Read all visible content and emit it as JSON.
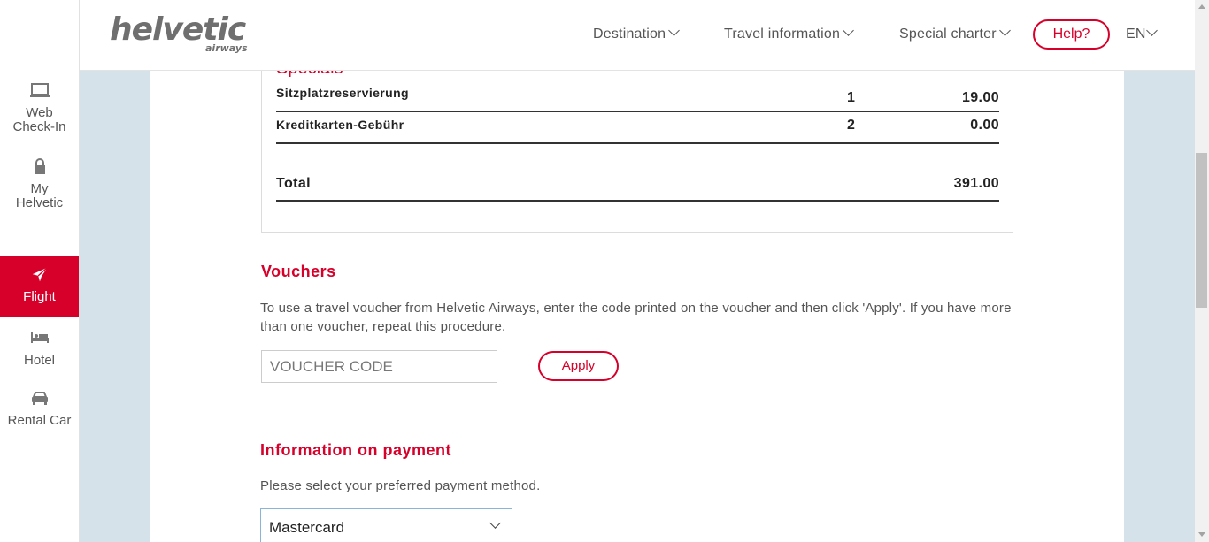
{
  "brand": {
    "logo_main": "helvetic",
    "logo_sub": "airways",
    "accent_color": "#d6002a"
  },
  "sidebar": {
    "items": [
      {
        "label": "Web Check-In",
        "icon": "laptop-icon"
      },
      {
        "label": "My Helvetic",
        "icon": "lock-icon"
      },
      {
        "label": "Flight",
        "icon": "airplane-icon",
        "active": true
      },
      {
        "label": "Hotel",
        "icon": "bed-icon"
      },
      {
        "label": "Rental Car",
        "icon": "car-icon"
      }
    ]
  },
  "nav": {
    "items": [
      {
        "label": "Destination"
      },
      {
        "label": "Travel information"
      },
      {
        "label": "Special charter"
      }
    ],
    "help_label": "Help?",
    "language": "EN"
  },
  "summary": {
    "specials_title": "Specials",
    "rows": [
      {
        "label": "Sitzplatzreservierung",
        "qty": "1",
        "amount": "19.00"
      },
      {
        "label": "Kreditkarten-Gebühr",
        "qty": "2",
        "amount": "0.00"
      }
    ],
    "total_label": "Total",
    "total_amount": "391.00"
  },
  "vouchers": {
    "title": "Vouchers",
    "description": "To use a travel voucher from Helvetic Airways, enter the code printed on the voucher and then click 'Apply'. If you have more than one voucher, repeat this procedure.",
    "placeholder": "VOUCHER CODE",
    "apply_label": "Apply"
  },
  "payment": {
    "title": "Information on payment",
    "description": "Please select your preferred payment method.",
    "selected_method": "Mastercard"
  }
}
